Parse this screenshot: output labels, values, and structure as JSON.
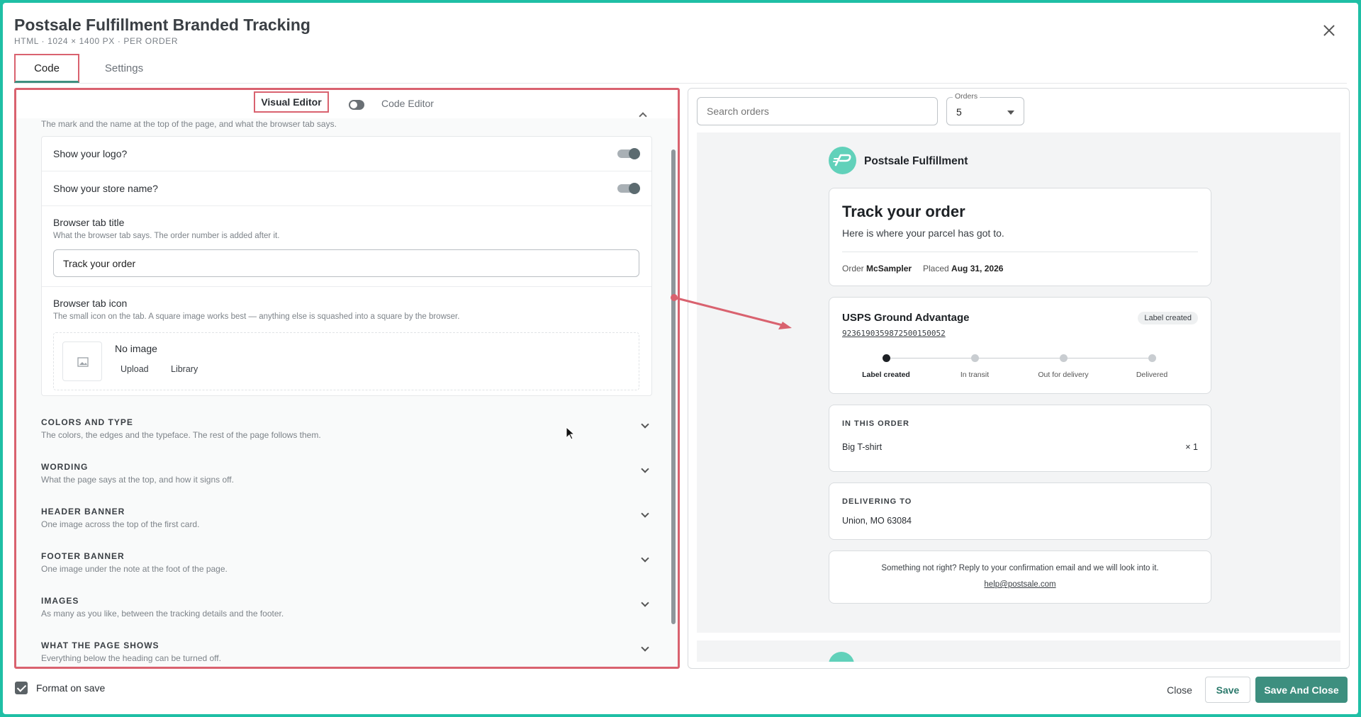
{
  "header": {
    "title": "Postsale Fulfillment Branded Tracking",
    "subtitle": "HTML · 1024 × 1400 PX · PER ORDER"
  },
  "tabs": [
    {
      "label": "Code",
      "active": true
    },
    {
      "label": "Settings",
      "active": false
    }
  ],
  "editor": {
    "visual_label": "Visual Editor",
    "code_label": "Code Editor",
    "mode": "visual",
    "section_desc": "The mark and the name at the top of the page, and what the browser tab says.",
    "show_logo_label": "Show your logo?",
    "show_logo": true,
    "show_store_label": "Show your store name?",
    "show_store": true,
    "tab_title_label": "Browser tab title",
    "tab_title_help": "What the browser tab says. The order number is added after it.",
    "tab_title_value": "Track your order",
    "tab_icon_label": "Browser tab icon",
    "tab_icon_help": "The small icon on the tab. A square image works best — anything else is squashed into a square by the browser.",
    "no_image": "No image",
    "upload": "Upload",
    "library": "Library",
    "sections": [
      {
        "title": "COLORS AND TYPE",
        "desc": "The colors, the edges and the typeface. The rest of the page follows them."
      },
      {
        "title": "WORDING",
        "desc": "What the page says at the top, and how it signs off."
      },
      {
        "title": "HEADER BANNER",
        "desc": "One image across the top of the first card."
      },
      {
        "title": "FOOTER BANNER",
        "desc": "One image under the note at the foot of the page."
      },
      {
        "title": "IMAGES",
        "desc": "As many as you like, between the tracking details and the footer."
      },
      {
        "title": "WHAT THE PAGE SHOWS",
        "desc": "Everything below the heading can be turned off."
      }
    ]
  },
  "preview": {
    "search_placeholder": "Search orders",
    "orders_label": "Orders",
    "orders_value": "5",
    "brand_name": "Postsale Fulfillment",
    "track_title": "Track your order",
    "track_sub": "Here is where your parcel has got to.",
    "order_label": "Order",
    "order_value": "McSampler",
    "placed_label": "Placed",
    "placed_value": "Aug 31, 2026",
    "carrier": "USPS Ground Advantage",
    "status_badge": "Label created",
    "tracking_number": "9236190359872500150052",
    "steps": [
      "Label created",
      "In transit",
      "Out for delivery",
      "Delivered"
    ],
    "active_step": 0,
    "items_heading": "IN THIS ORDER",
    "item_name": "Big T-shirt",
    "item_qty": "× 1",
    "delivering_heading": "DELIVERING TO",
    "address": "Union, MO 63084",
    "footer_note": "Something not right? Reply to your confirmation email and we will look into it.",
    "footer_email": "help@postsale.com"
  },
  "footer": {
    "format_on_save_label": "Format on save",
    "format_on_save": true,
    "close_label": "Close",
    "save_label": "Save",
    "save_close_label": "Save And Close"
  },
  "colors": {
    "accent": "#3d8f7f",
    "brand_logo": "#61d1ba",
    "annotation": "#d9626f"
  }
}
